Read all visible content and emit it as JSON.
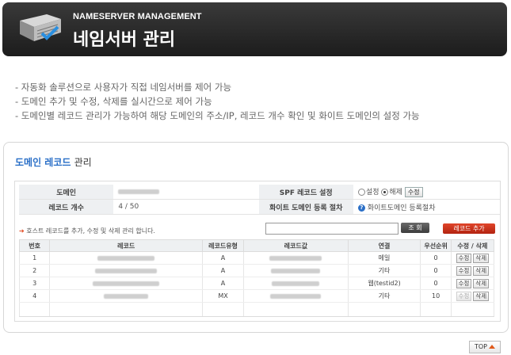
{
  "header": {
    "subtitle": "NAMESERVER MANAGEMENT",
    "title": "네임서버 관리",
    "icon": "server-icon"
  },
  "description": [
    "- 자동화 솔루션으로 사용자가 직접 네임서버를 제어 가능",
    "- 도메인 추가 및 수정, 삭제를 실시간으로 제어 가능",
    "- 도메인별 레코드 관리가 가능하여 해당 도메인의 주소/IP, 레코드 개수 확인 및 화이트 도메인의 설정 가능"
  ],
  "panel": {
    "title_highlight": "도메인 레코드",
    "title_rest": "관리"
  },
  "info": {
    "domain_label": "도메인",
    "spf_label": "SPF 레코드 설정",
    "spf_on": "설정",
    "spf_off": "해제",
    "spf_selected": "해제",
    "modify_button": "수정",
    "record_count_label": "레코드 개수",
    "record_count_value": "4 / 50",
    "white_label": "화이트 도메인 등록 절차",
    "white_link": "화이트도메인 등록절차"
  },
  "toolbar": {
    "notice": "호스트 레코드를 추가, 수정 및 삭제 관리 합니다.",
    "search_button": "조 회",
    "add_button": "레코드 추가"
  },
  "table": {
    "headers": [
      "번호",
      "레코드",
      "레코드유형",
      "레코드값",
      "연결",
      "우선순위",
      "수정 / 삭제"
    ],
    "rows": [
      {
        "no": "1",
        "type": "A",
        "link": "메일",
        "priority": "0"
      },
      {
        "no": "2",
        "type": "A",
        "link": "기타",
        "priority": "0"
      },
      {
        "no": "3",
        "type": "A",
        "link": "웹(testid2)",
        "priority": "0"
      },
      {
        "no": "4",
        "type": "MX",
        "link": "기타",
        "priority": "10"
      }
    ],
    "edit_label": "수정",
    "delete_label": "삭제"
  },
  "footer": {
    "top_button": "TOP"
  },
  "colors": {
    "accent_blue": "#2a6fc7",
    "add_red": "#c8301a",
    "header_dark": "#2a2a2a"
  }
}
